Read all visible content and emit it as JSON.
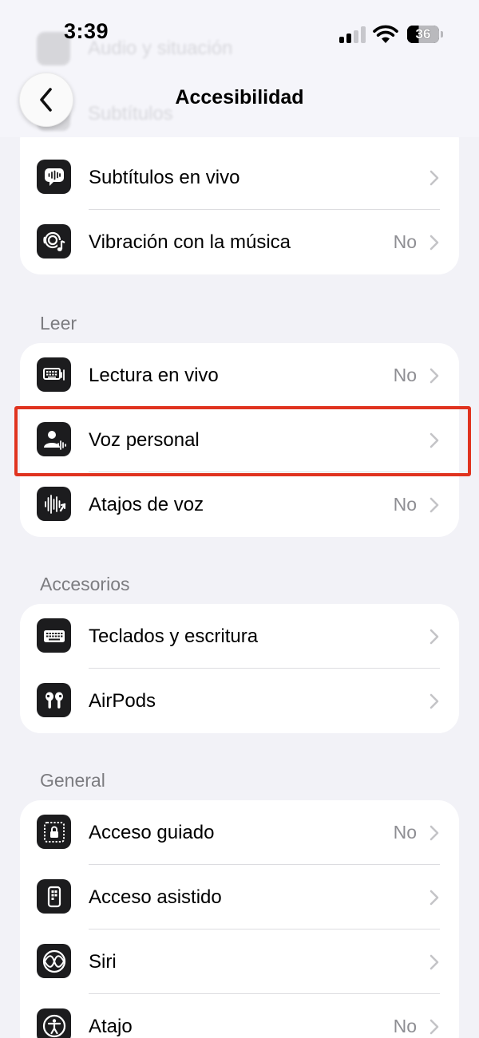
{
  "status": {
    "time": "3:39",
    "battery": "36"
  },
  "nav": {
    "title": "Accesibilidad",
    "behind_1": "Audio y situación",
    "behind_2": "Subtítulos"
  },
  "group_top": {
    "items": [
      {
        "label": "Subtítulos en vivo",
        "value": "",
        "icon": "live-captions-icon"
      },
      {
        "label": "Vibración con la música",
        "value": "No",
        "icon": "music-haptics-icon"
      }
    ]
  },
  "sections": [
    {
      "title": "Leer",
      "items": [
        {
          "label": "Lectura en vivo",
          "value": "No",
          "icon": "live-speech-icon"
        },
        {
          "label": "Voz personal",
          "value": "",
          "icon": "personal-voice-icon",
          "highlighted": true
        },
        {
          "label": "Atajos de voz",
          "value": "No",
          "icon": "vocal-shortcuts-icon"
        }
      ]
    },
    {
      "title": "Accesorios",
      "items": [
        {
          "label": "Teclados y escritura",
          "value": "",
          "icon": "keyboard-icon"
        },
        {
          "label": "AirPods",
          "value": "",
          "icon": "airpods-icon"
        }
      ]
    },
    {
      "title": "General",
      "items": [
        {
          "label": "Acceso guiado",
          "value": "No",
          "icon": "guided-access-icon"
        },
        {
          "label": "Acceso asistido",
          "value": "",
          "icon": "assistive-access-icon"
        },
        {
          "label": "Siri",
          "value": "",
          "icon": "siri-icon"
        },
        {
          "label": "Atajo",
          "value": "No",
          "icon": "accessibility-shortcut-icon"
        }
      ]
    }
  ],
  "colors": {
    "background": "#f2f2f7",
    "highlight": "#e0331f",
    "icon_bg": "#1c1c1e"
  }
}
